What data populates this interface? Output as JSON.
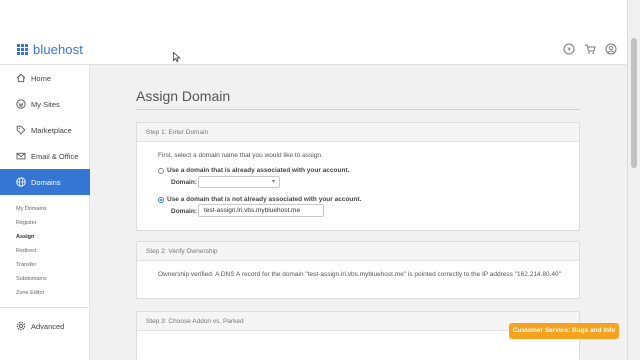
{
  "brand": {
    "name": "bluehost",
    "accent": "#3575d3"
  },
  "header": {
    "icons": [
      "help-icon",
      "cart-icon",
      "account-icon"
    ]
  },
  "sidebar": {
    "items": [
      {
        "label": "Home",
        "icon": "home-icon"
      },
      {
        "label": "My Sites",
        "icon": "wordpress-icon"
      },
      {
        "label": "Marketplace",
        "icon": "tag-icon"
      },
      {
        "label": "Email & Office",
        "icon": "mail-icon"
      },
      {
        "label": "Domains",
        "icon": "globe-icon",
        "active": true
      }
    ],
    "subitems": [
      "My Domains",
      "Register",
      "Assign",
      "Redirect",
      "Transfer",
      "Subdomains",
      "Zone Editor"
    ],
    "active_subitem": "Assign",
    "advanced": {
      "label": "Advanced",
      "icon": "gear-icon"
    }
  },
  "main": {
    "title": "Assign Domain",
    "step1": {
      "heading": "Step 1: Enter Domain",
      "intro": "First, select a domain name that you would like to assign.",
      "option_existing": "Use a domain that is already associated with your account.",
      "option_new": "Use a domain that is not already associated with your account.",
      "domain_label": "Domain:",
      "domain_select_value": "",
      "domain_input_value": "test-assign.lri.vbs.mybluehost.me",
      "selected_option": "new"
    },
    "step2": {
      "heading": "Step 2: Verify Ownership",
      "text": "Ownership verified. A DNS A record for the domain \"test-assign.lri.vbs.mybluehost.me\" is pointed correctly to the IP address \"162.214.80.40\""
    },
    "step3": {
      "heading": "Step 3: Choose Addon vs. Parked"
    }
  },
  "support": {
    "label": "Customer Service: Bugs and Info",
    "color": "#f6a21e"
  }
}
